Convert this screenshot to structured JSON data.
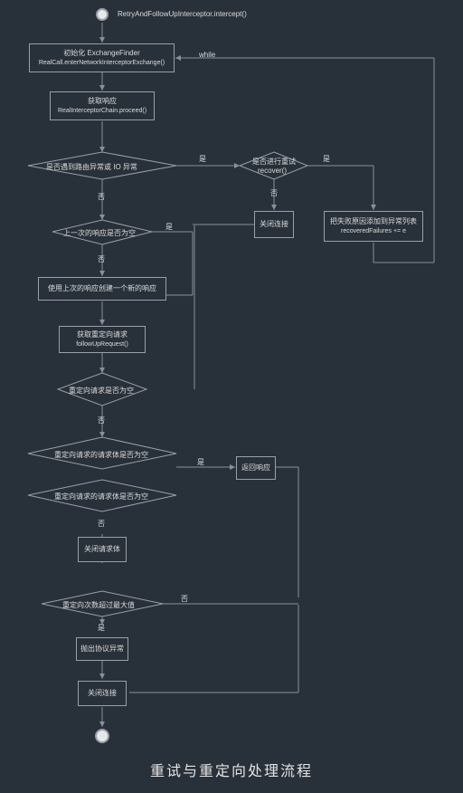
{
  "title": "重试与重定向处理流程",
  "start_label": "RetryAndFollowUpInterceptor.intercept()",
  "init_l1": "初始化 ExchangeFinder",
  "init_l2": "RealCall.enterNetworkInterceptorExchange()",
  "proceed_l1": "获取响应",
  "proceed_l2": "RealInterceptorChain.proceed()",
  "dec_io": "是否遇到路由异常或 IO 异常",
  "dec_retry_l1": "是否进行重试",
  "dec_retry_l2": "recover()",
  "close_conn": "关闭连接",
  "add_fail_l1": "把失败原因添加到异常列表",
  "add_fail_l2": "recoveredFailures += e",
  "dec_prev": "上一次的响应是否为空",
  "build_new": "使用上次的响应创建一个新的响应",
  "followup_l1": "获取重定向请求",
  "followup_l2": "followUpRequest()",
  "dec_fu_null": "重定向请求是否为空",
  "dec_body": "重定向请求的请求体是否为空",
  "close_body": "关闭请求体",
  "dec_max": "重定向次数超过最大值",
  "throw_proto": "抛出协议异常",
  "close_conn2": "关闭连接",
  "return_resp": "返回响应",
  "edge_while": "while",
  "edge_yes": "是",
  "edge_no": "否"
}
